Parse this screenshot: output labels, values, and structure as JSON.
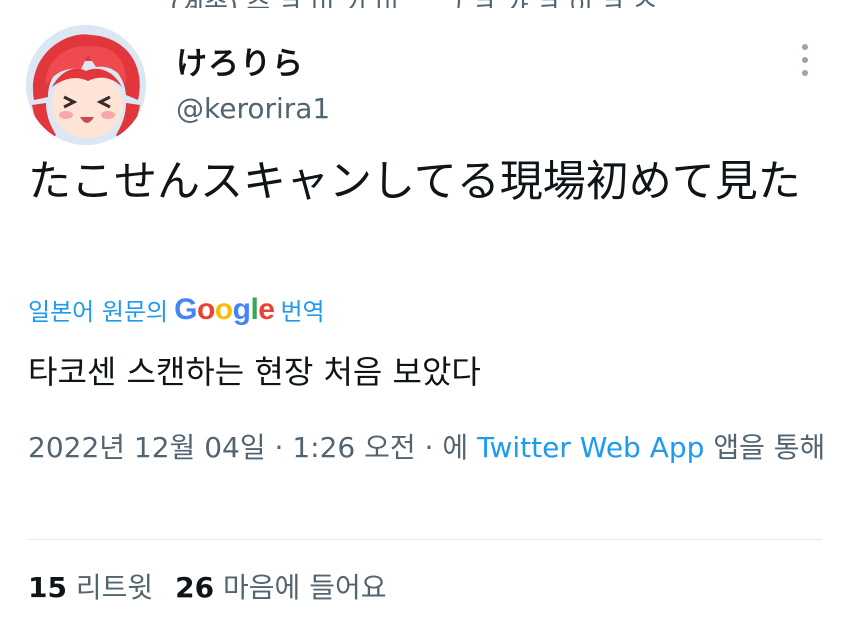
{
  "top_partial_text": "(계속) 수 ㅋ 미 기 미 ... 그 ㅋ 가 ㅋ 이 ㅋ 스 ...",
  "user": {
    "name": "けろりら",
    "handle": "@kerorira1"
  },
  "tweet": {
    "text": "たこせんスキャンしてる現場初めて見た"
  },
  "translation": {
    "prefix": "일본어 원문의",
    "brand": "Google",
    "suffix": "번역",
    "text": "타코센 스캔하는 현장 처음 보았다"
  },
  "meta": {
    "date": "2022년 12월 04일",
    "sep1": "·",
    "time": "1:26 오전",
    "sep2": "·",
    "via_prefix": "에",
    "app": "Twitter Web App",
    "via_suffix": "앱을 통해"
  },
  "stats": {
    "retweets_count": "15",
    "retweets_label": "리트윗",
    "likes_count": "26",
    "likes_label": "마음에 들어요"
  },
  "icons": {
    "more": "more-vertical-icon"
  },
  "colors": {
    "link": "#1d9bf0",
    "secondary_text": "#536471",
    "primary_text": "#0f1419",
    "divider": "#e3e8ec"
  }
}
